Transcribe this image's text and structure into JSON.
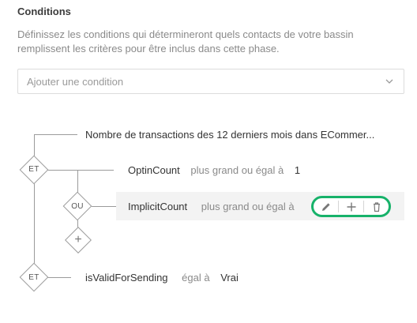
{
  "section": {
    "title": "Conditions",
    "description": "Définissez les conditions qui détermineront quels contacts de votre bassin remplissent les critères pour être inclus dans cette phase."
  },
  "add_condition": {
    "placeholder": "Ajouter une condition",
    "icon": "chevron-down-icon"
  },
  "tree": {
    "operators": {
      "and_top": "ET",
      "or": "OU",
      "and_bottom": "ET"
    },
    "conditions": [
      {
        "field": "Nombre de transactions des 12 derniers mois dans ECommer...",
        "operator": "",
        "value": ""
      },
      {
        "field": "OptinCount",
        "operator": "plus grand ou égal à",
        "value": "1"
      },
      {
        "field": "ImplicitCount",
        "operator": "plus grand ou égal à",
        "value": ""
      },
      {
        "field": "isValidForSending",
        "operator": "égal à",
        "value": "Vrai"
      }
    ]
  },
  "row_actions": {
    "edit_icon": "pencil-icon",
    "add_icon": "plus-icon",
    "delete_icon": "trash-icon"
  },
  "colors": {
    "accent": "#17b26a",
    "lines": "#9b9b9b",
    "muted_text": "#8a8a8a"
  }
}
